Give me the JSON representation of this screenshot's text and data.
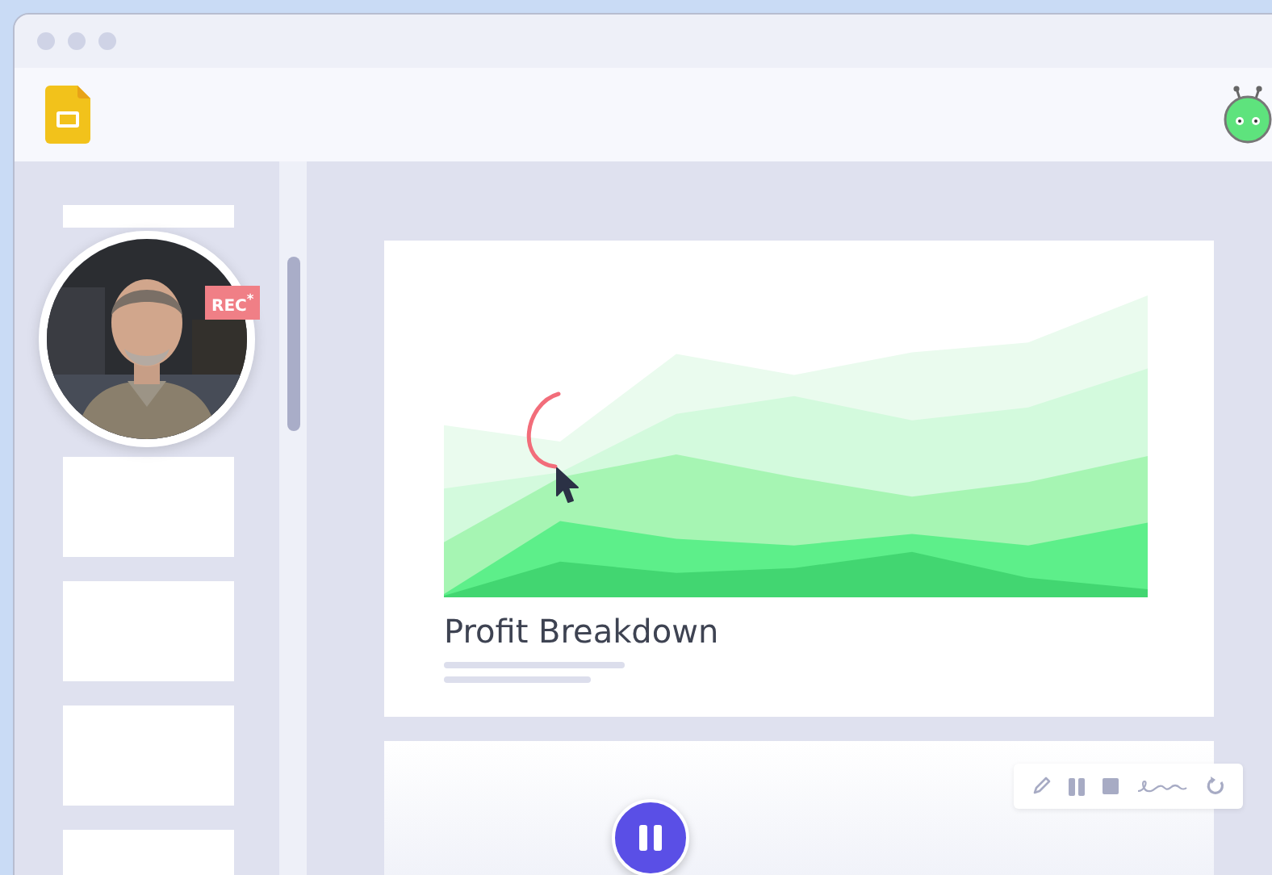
{
  "slides": [
    {
      "kind": "covered"
    },
    {
      "kind": "blank"
    },
    {
      "kind": "blank"
    },
    {
      "kind": "blank"
    },
    {
      "kind": "blank"
    }
  ],
  "webcam": {
    "kind": "picture",
    "badge": "REC$^{*}$"
  },
  "slide": {
    "title": "Profit Breakdown"
  },
  "toolbar": {
    "tools": [
      {
        "kind": "pen"
      },
      {
        "kind": "pause"
      },
      {
        "kind": "stop"
      },
      {
        "kind": "signature"
      },
      {
        "kind": "redo"
      }
    ]
  },
  "recording": {
    "paused": false
  }
}
